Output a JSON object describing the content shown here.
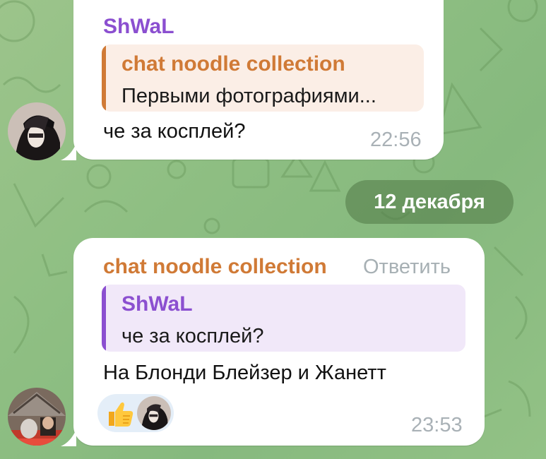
{
  "messages": [
    {
      "sender": "ShWaL",
      "sender_color": "#8b4fd0",
      "reply": {
        "name": "chat noodle collection",
        "text": "Первыми фотографиями...",
        "accent": "#d07a36",
        "background": "#fbeee6"
      },
      "text": "че за косплей?",
      "time": "22:56",
      "avatar": "goth-avatar"
    },
    {
      "sender": "chat noodle collection",
      "sender_color": "#d07a36",
      "reply_button": "Ответить",
      "reply": {
        "name": "ShWaL",
        "text": "че за косплей?",
        "accent": "#8b4fd0",
        "background": "#f1e8f9"
      },
      "text": "На Блонди Блейзер и Жанетт",
      "time": "23:53",
      "reaction": {
        "emoji": "thumbs-up-icon"
      },
      "avatar": "group-avatar"
    }
  ],
  "date_separator": "12 декабря",
  "colors": {
    "background": "#93c286",
    "bubble": "#ffffff",
    "time": "#a9b1b6"
  }
}
